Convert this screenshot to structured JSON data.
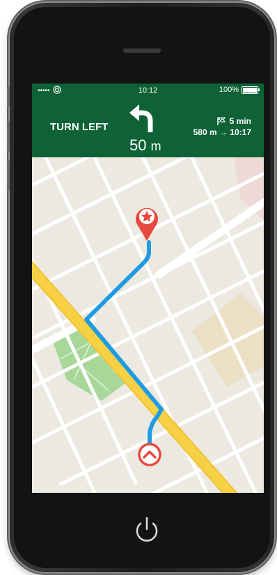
{
  "status_bar": {
    "signal": "•••••",
    "time": "10:12",
    "battery_text": "100%",
    "battery_level": 1.0
  },
  "navigation": {
    "instruction": "TURN LEFT",
    "turn_icon": "turn-left-arrow-icon",
    "distance_value": "50",
    "distance_unit": "m",
    "eta_duration": "5 min",
    "remaining_and_arrival": "580 m → 10:17"
  },
  "map": {
    "destination_icon": "star-pin-icon",
    "current_location_icon": "chevron-up-icon"
  },
  "colors": {
    "header_bg": "#0e6236",
    "route": "#1e9be3",
    "pin": "#e8493e",
    "major_road": "#f6d146",
    "park": "#a8d79a",
    "map_bg": "#ece9e1",
    "phone_body": "#1a1a1a"
  },
  "device": {
    "power_icon": "power-icon"
  }
}
